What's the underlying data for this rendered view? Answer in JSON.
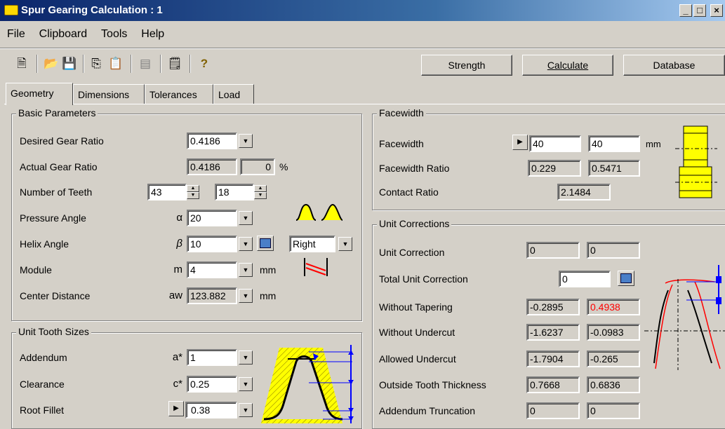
{
  "window": {
    "title": "Spur Gearing Calculation : 1",
    "controls": [
      "_",
      "□",
      "×"
    ]
  },
  "menu": [
    "File",
    "Clipboard",
    "Tools",
    "Help"
  ],
  "toolbar": {
    "icons": [
      "new-icon",
      "open-icon",
      "save-icon",
      "copy-icon",
      "paste-icon",
      "print-preview-icon",
      "report-icon",
      "help-icon"
    ],
    "strength_label": "Strength",
    "calculate_label": "Calculate",
    "database_label": "Database"
  },
  "tabs": [
    "Geometry",
    "Dimensions",
    "Tolerances",
    "Load"
  ],
  "basic": {
    "title": "Basic Parameters",
    "desired_gear_ratio": {
      "label": "Desired Gear Ratio",
      "value": "0.4186"
    },
    "actual_gear_ratio": {
      "label": "Actual Gear Ratio",
      "value": "0.4186",
      "deviation": "0",
      "unit": "%"
    },
    "number_of_teeth": {
      "label": "Number of Teeth",
      "z1": "43",
      "z2": "18"
    },
    "pressure_angle": {
      "label": "Pressure Angle",
      "symbol": "α",
      "value": "20"
    },
    "helix_angle": {
      "label": "Helix Angle",
      "symbol": "β",
      "value": "10",
      "direction": "Right"
    },
    "module": {
      "label": "Module",
      "symbol": "m",
      "value": "4",
      "unit": "mm"
    },
    "center_distance": {
      "label": "Center Distance",
      "symbol": "aw",
      "value": "123.882",
      "unit": "mm"
    }
  },
  "tooth": {
    "title": "Unit Tooth Sizes",
    "addendum": {
      "label": "Addendum",
      "symbol": "a*",
      "value": "1"
    },
    "clearance": {
      "label": "Clearance",
      "symbol": "c*",
      "value": "0.25"
    },
    "root_fillet": {
      "label": "Root Fillet",
      "value": "0.38"
    }
  },
  "facewidth": {
    "title": "Facewidth",
    "facewidth": {
      "label": "Facewidth",
      "b1": "40",
      "b2": "40",
      "unit": "mm"
    },
    "ratio": {
      "label": "Facewidth Ratio",
      "v1": "0.229",
      "v2": "0.5471"
    },
    "contact": {
      "label": "Contact Ratio",
      "value": "2.1484"
    }
  },
  "corrections": {
    "title": "Unit Corrections",
    "unit_correction": {
      "label": "Unit Correction",
      "x1": "0",
      "x2": "0"
    },
    "total_unit_correction": {
      "label": "Total Unit Correction",
      "value": "0"
    },
    "without_tapering": {
      "label": "Without Tapering",
      "v1": "-0.2895",
      "v2": "0.4938"
    },
    "without_undercut": {
      "label": "Without Undercut",
      "v1": "-1.6237",
      "v2": "-0.0983"
    },
    "allowed_undercut": {
      "label": "Allowed Undercut",
      "v1": "-1.7904",
      "v2": "-0.265"
    },
    "outside_tooth_thickness": {
      "label": "Outside Tooth Thickness",
      "v1": "0.7668",
      "v2": "0.6836"
    },
    "addendum_truncation": {
      "label": "Addendum Truncation",
      "v1": "0",
      "v2": "0"
    }
  },
  "colors": {
    "title_start": "#0a246a",
    "accent_yellow": "#ffff00",
    "warning_red": "#ff0000",
    "face": "#d4d0c8"
  }
}
